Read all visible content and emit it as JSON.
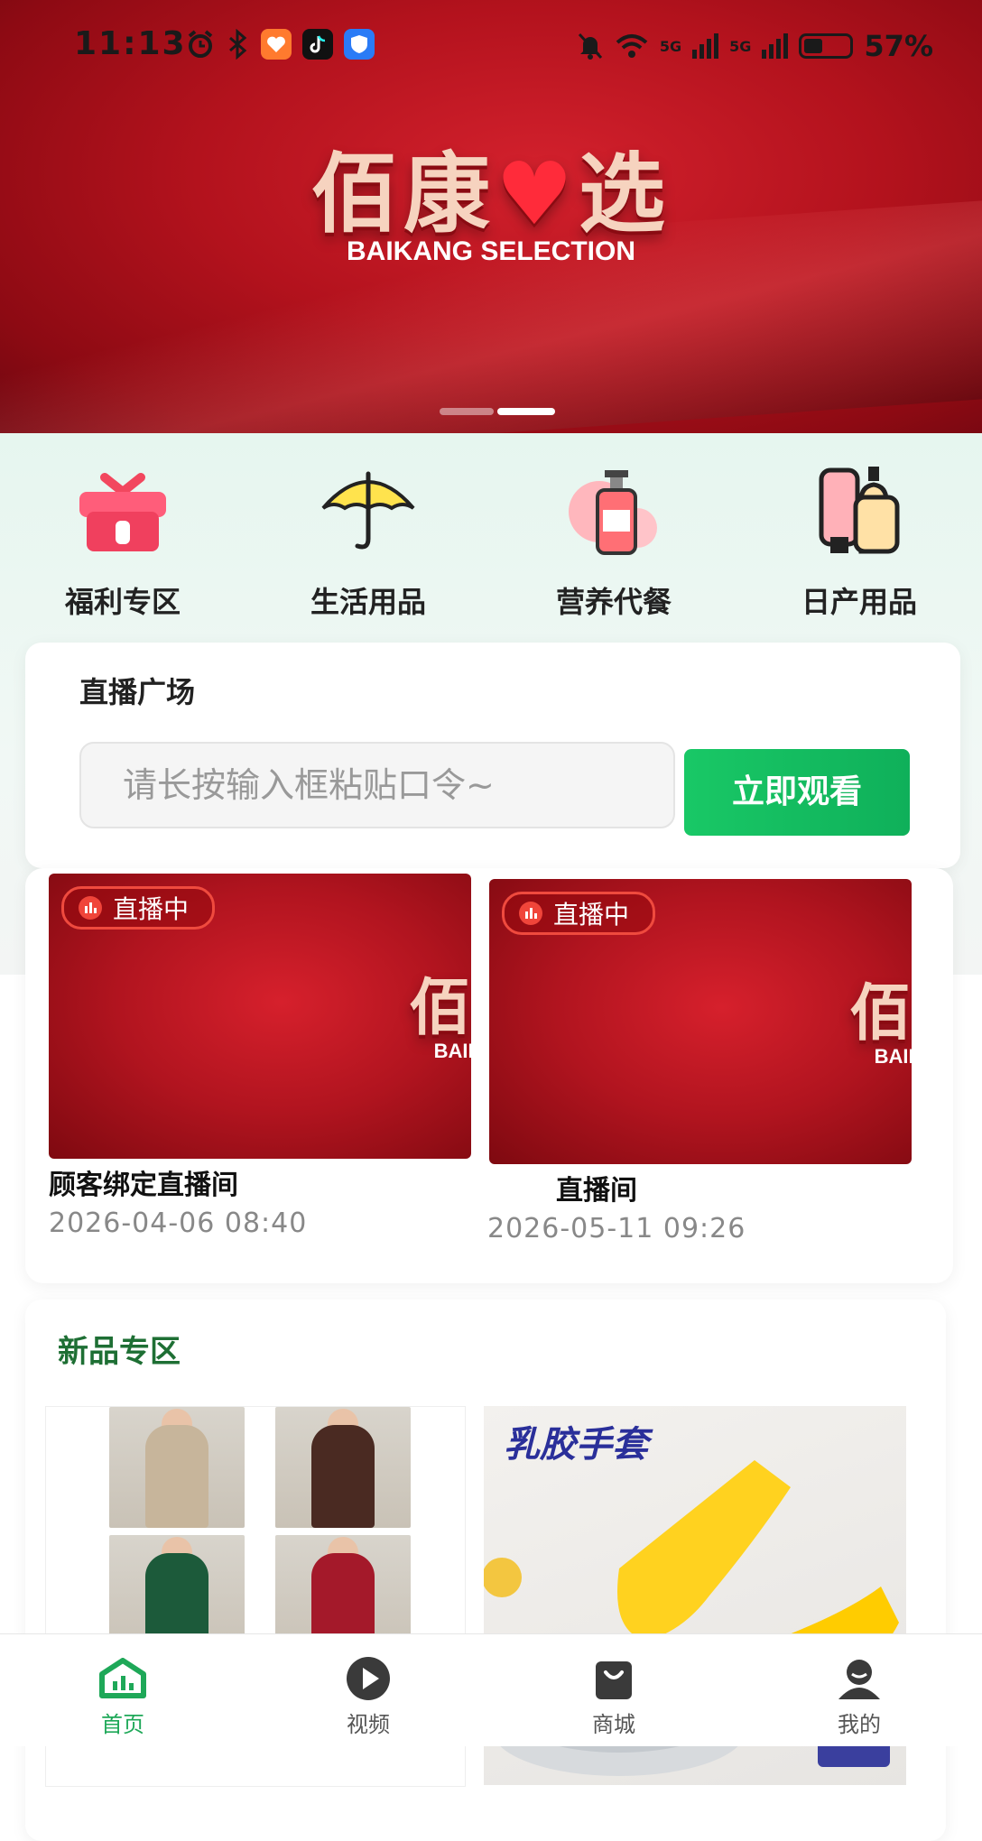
{
  "status_bar": {
    "time": "11:13",
    "network_5g_1": "5G",
    "network_5g_2": "5G",
    "battery": "57%"
  },
  "banner": {
    "logo_cn_1": "佰康",
    "logo_heart": "♥",
    "logo_cn_2": "选",
    "logo_en": "BAIKANG SELECTION"
  },
  "categories": [
    {
      "label": "福利专区",
      "icon": "gift-box-icon"
    },
    {
      "label": "生活用品",
      "icon": "umbrella-icon"
    },
    {
      "label": "营养代餐",
      "icon": "bottle-icon"
    },
    {
      "label": "日产用品",
      "icon": "cosmetics-icon"
    }
  ],
  "live_plaza": {
    "title": "直播广场",
    "input_placeholder": "请长按输入框粘贴口令~",
    "watch_button": "立即观看"
  },
  "live_rooms": [
    {
      "badge": "直播中",
      "name": "顾客绑定直播间",
      "date": "2026-04-06 08:40"
    },
    {
      "badge": "直播中",
      "name": "直播间",
      "date": "2026-05-11 09:26"
    }
  ],
  "new_products": {
    "title": "新品专区",
    "product2_title": "乳胶手套"
  },
  "nav": {
    "items": [
      {
        "label": "首页",
        "icon": "home-icon"
      },
      {
        "label": "视频",
        "icon": "play-icon"
      },
      {
        "label": "商城",
        "icon": "shopping-bag-icon"
      },
      {
        "label": "我的",
        "icon": "user-icon"
      }
    ]
  },
  "colors": {
    "brand_red": "#b3121d",
    "accent_green": "#1ea858",
    "zone_title_green": "#1e6f34"
  }
}
